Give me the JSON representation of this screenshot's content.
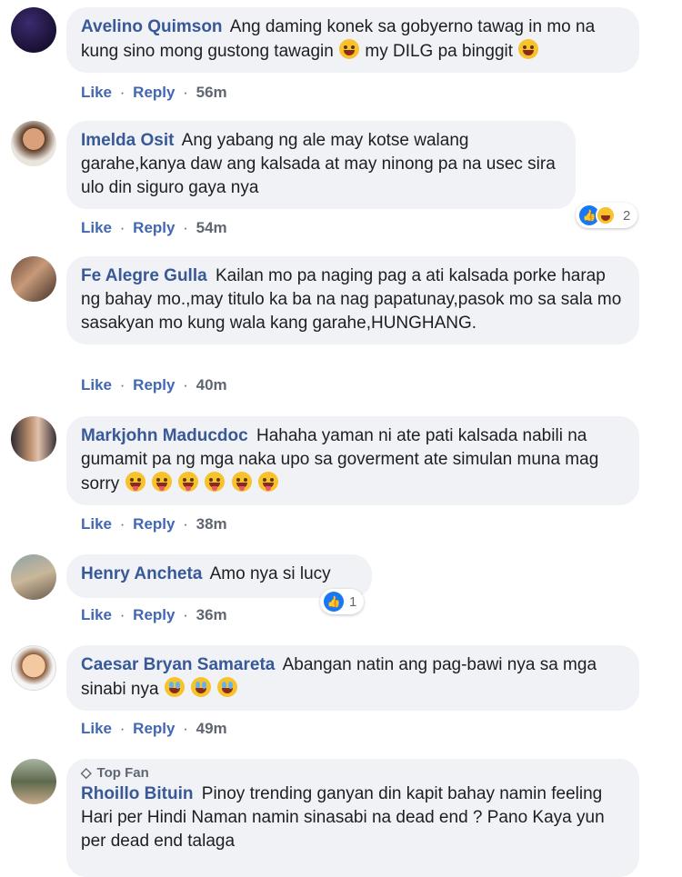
{
  "actions": {
    "like": "Like",
    "reply": "Reply",
    "sep": "·"
  },
  "comments": [
    {
      "name": "Avelino Quimson",
      "text1": "Ang daming konek sa gobyerno tawag in mo na kung sino mong gustong tawagin",
      "text2": " my DILG pa binggit",
      "time": "56m"
    },
    {
      "name": "Imelda Osit",
      "text": "Ang yabang ng ale may kotse walang garahe,kanya daw ang kalsada at may ninong pa na usec sira ulo din siguro gaya nya",
      "time": "54m",
      "reaction_count": "2"
    },
    {
      "name": "Fe Alegre Gulla",
      "text": "Kailan mo pa naging pag a ati kalsada porke harap ng bahay mo.,may titulo ka ba na nag papatunay,pasok mo sa sala mo sasakyan mo kung wala kang garahe,HUNGHANG.",
      "time": "40m"
    },
    {
      "name": "Markjohn Maducdoc",
      "text": "Hahaha yaman ni ate pati kalsada nabili na gumamit pa ng mga naka upo sa goverment ate simulan muna mag sorry",
      "time": "38m"
    },
    {
      "name": "Henry Ancheta",
      "text": "Amo nya si lucy",
      "time": "36m",
      "reaction_count": "1"
    },
    {
      "name": "Caesar Bryan Samareta",
      "text": "Abangan natin ang pag-bawi nya sa mga sinabi nya",
      "time": "49m"
    },
    {
      "badge": "Top Fan",
      "name": "Rhoillo Bituin",
      "text": "Pinoy trending ganyan din kapit bahay namin feeling Hari per Hindi Naman namin sinasabi na dead end ? Pano Kaya yun per dead end talaga"
    }
  ],
  "colors": {
    "name": "#385898",
    "link": "#4267b2",
    "bubble": "#f0f2f5",
    "like_blue": "#1877f2"
  }
}
